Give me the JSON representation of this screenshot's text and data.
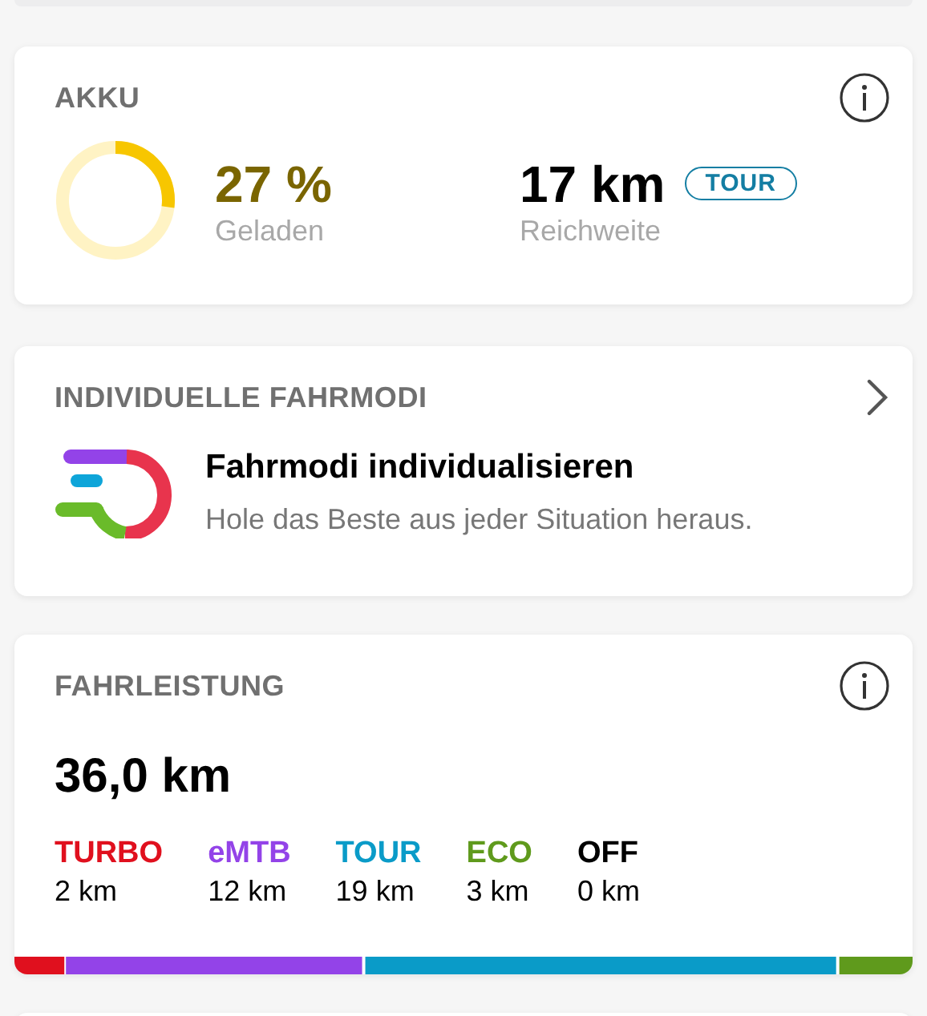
{
  "battery": {
    "title": "AKKU",
    "level": 0.27,
    "charge": "27 %",
    "charge_label": "Geladen",
    "range": "17 km",
    "range_mode": "TOUR",
    "range_label": "Reichweite"
  },
  "custom_modes": {
    "title": "INDIVIDUELLE FAHRMODI",
    "heading": "Fahrmodi individualisieren",
    "text": "Hole das Beste aus jeder Situation heraus."
  },
  "performance": {
    "title": "FAHRLEISTUNG",
    "total": "36,0 km",
    "modes": [
      {
        "name": "TURBO",
        "distance": "2 km",
        "color": "#e0101e"
      },
      {
        "name": "eMTB",
        "distance": "12 km",
        "color": "#9343e8"
      },
      {
        "name": "TOUR",
        "distance": "19 km",
        "color": "#0a9bc8"
      },
      {
        "name": "ECO",
        "distance": "3 km",
        "color": "#5f9a1c"
      },
      {
        "name": "OFF",
        "distance": "0 km",
        "color": "#000000"
      }
    ]
  }
}
